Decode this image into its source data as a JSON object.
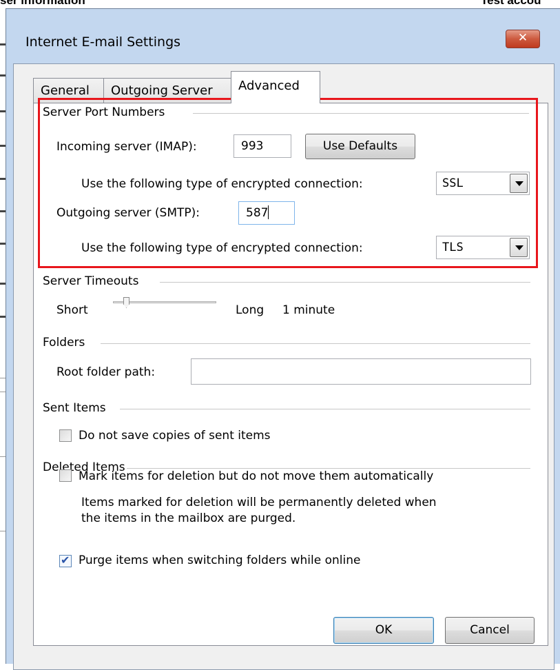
{
  "background_window": {
    "title_left": "ser information",
    "title_right": "Test accou"
  },
  "dialog": {
    "title": "Internet E-mail Settings",
    "close_icon": "close-icon",
    "tabs": [
      {
        "label": "General",
        "active": false
      },
      {
        "label": "Outgoing Server",
        "active": false
      },
      {
        "label": "Advanced",
        "active": true
      }
    ],
    "server_port_numbers": {
      "title": "Server Port Numbers",
      "incoming_label": "Incoming server (IMAP):",
      "incoming_value": "993",
      "use_defaults_label": "Use Defaults",
      "incoming_encryption_label": "Use the following type of encrypted connection:",
      "incoming_encryption_value": "SSL",
      "outgoing_label": "Outgoing server (SMTP):",
      "outgoing_value": "587",
      "outgoing_encryption_label": "Use the following type of encrypted connection:",
      "outgoing_encryption_value": "TLS",
      "highlight_color": "#e8161c"
    },
    "server_timeouts": {
      "title": "Server Timeouts",
      "short_label": "Short",
      "long_label": "Long",
      "value_label": "1 minute",
      "slider_level_fraction": 0.1
    },
    "folders": {
      "title": "Folders",
      "root_label": "Root folder path:",
      "root_value": ""
    },
    "sent_items": {
      "title": "Sent Items",
      "no_copies_label": "Do not save copies of sent items",
      "no_copies_checked": false
    },
    "deleted_items": {
      "title": "Deleted Items",
      "mark_label": "Mark items for deletion but do not move them automatically",
      "mark_checked": false,
      "note_line1": "Items marked for deletion will be permanently deleted when",
      "note_line2": "the items in the mailbox are purged.",
      "purge_label": "Purge items when switching folders while online",
      "purge_checked": true
    },
    "ok_label": "OK",
    "cancel_label": "Cancel"
  }
}
